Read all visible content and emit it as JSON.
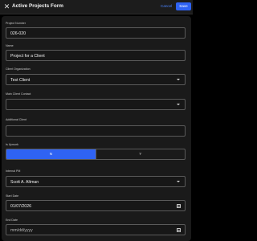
{
  "header": {
    "title": "Active Projects Form",
    "cancel_label": "Cancel",
    "save_label": "Save",
    "close_glyph": "✕"
  },
  "form": {
    "project_number": {
      "label": "Project Number",
      "value": "026-020"
    },
    "name": {
      "label": "Name",
      "value": "Project for a Client"
    },
    "client_organization": {
      "label": "Client Organization",
      "value": "Test Client"
    },
    "main_client_contact": {
      "label": "Main Client Contact",
      "value": ""
    },
    "additional_client": {
      "label": "Additional Client",
      "value": ""
    },
    "is_upwork": {
      "label": "Is Upwork",
      "options": [
        "N",
        "Y"
      ],
      "selected": "N"
    },
    "internal_pm": {
      "label": "Internal PM",
      "value": "Scott A. Altman"
    },
    "start_date": {
      "label": "Start Date",
      "value": "01/07/2026"
    },
    "end_date": {
      "label": "End Date",
      "placeholder": "mm/dd/yyyy"
    }
  },
  "colors": {
    "accent": "#2f63f4",
    "link": "#4a84ff",
    "background": "#000000",
    "panel": "#1a1a1a"
  }
}
